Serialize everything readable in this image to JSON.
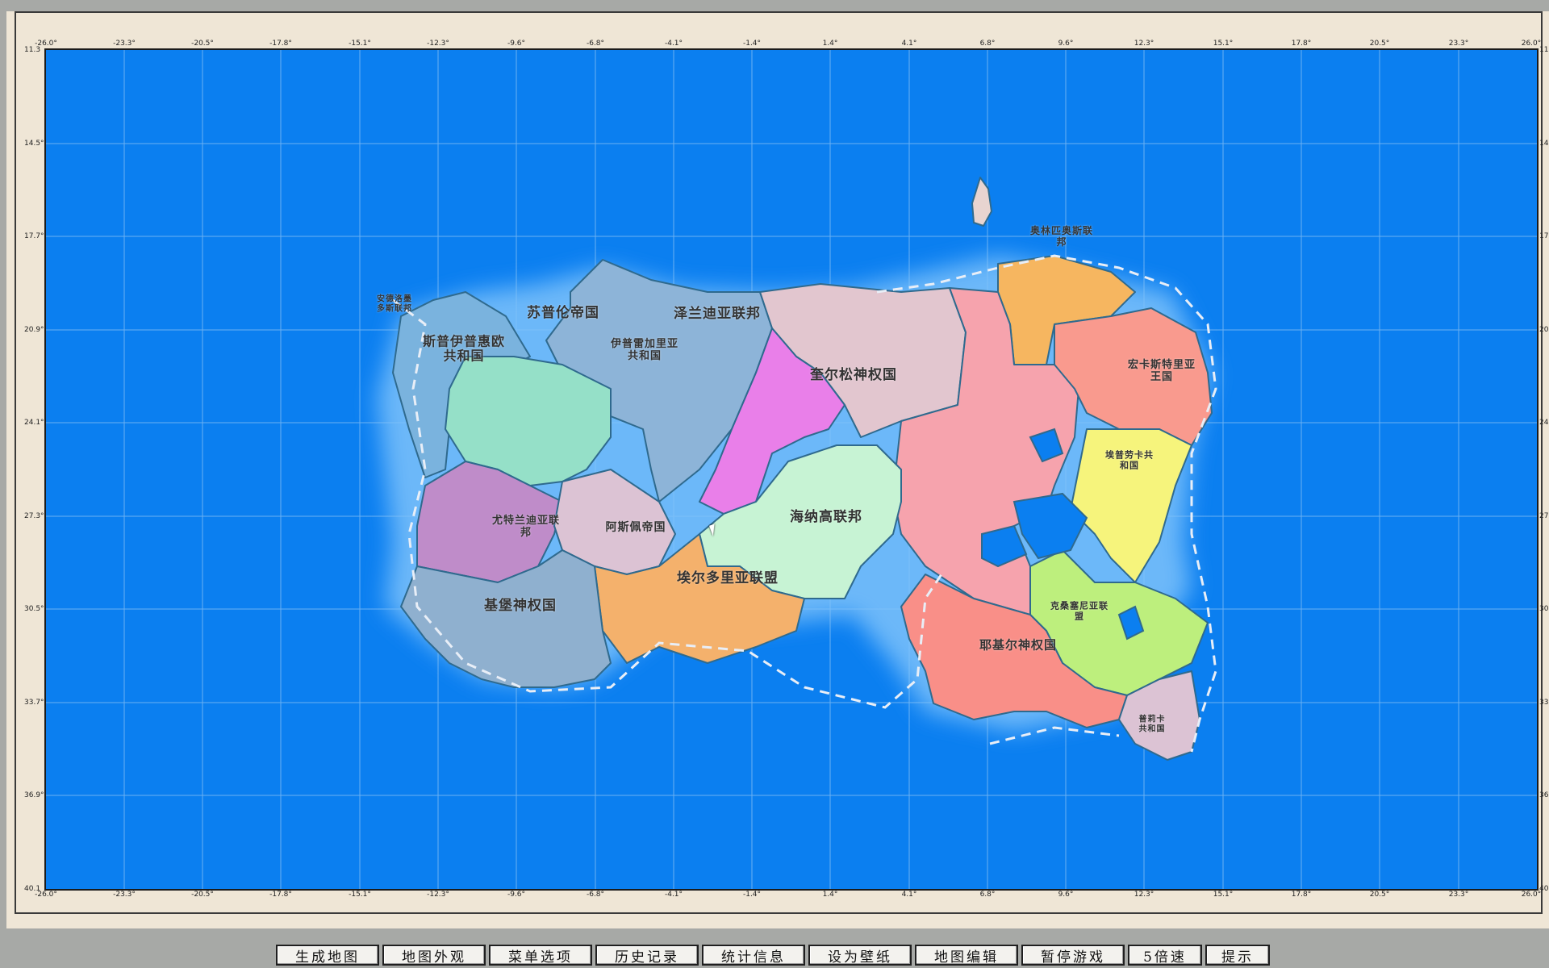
{
  "map": {
    "lon_labels": [
      "-26.0°",
      "-23.3°",
      "-20.5°",
      "-17.8°",
      "-15.1°",
      "-12.3°",
      "-9.6°",
      "-6.8°",
      "-4.1°",
      "-1.4°",
      "1.4°",
      "4.1°",
      "6.8°",
      "9.6°",
      "12.3°",
      "15.1°",
      "17.8°",
      "20.5°",
      "23.3°",
      "26.0°"
    ],
    "lat_labels": [
      "11.3°",
      "14.5°",
      "17.7°",
      "20.9°",
      "24.1°",
      "27.3°",
      "30.5°",
      "33.7°",
      "36.9°",
      "40.1°"
    ],
    "lat_labels_left": [
      "11.3",
      "14.5°",
      "17.7°",
      "20.9°",
      "24.1°",
      "27.3°",
      "30.5°",
      "33.7°",
      "36.9°",
      "40.1"
    ],
    "lat_labels_right": [
      "11.",
      "14.",
      "17.",
      "20.",
      "24.",
      "27.",
      "30.",
      "33.",
      "36.",
      "40."
    ],
    "ocean_color": "#0b7ff0",
    "countries": [
      {
        "name": "苏普伦帝国",
        "color": "#8db4d8"
      },
      {
        "name": "泽兰迪亚联邦",
        "color": "#e2c6cf"
      },
      {
        "name": "奥林匹奥斯联\n邦",
        "color": "#f6b660"
      },
      {
        "name": "安德洛墨\n多斯联邦",
        "color": "#7ab3de"
      },
      {
        "name": "斯普伊普惠欧\n共和国",
        "color": "#95e0c8"
      },
      {
        "name": "伊普雷加里亚\n共和国",
        "color": "#e97fe9"
      },
      {
        "name": "奎尔松神权国",
        "color": "#f6a3ad"
      },
      {
        "name": "宏卡斯特里亚\n王国",
        "color": "#f99a8e"
      },
      {
        "name": "埃普劳卡共\n和国",
        "color": "#f6f47c"
      },
      {
        "name": "尤特兰迪亚联\n邦",
        "color": "#bf8cc9"
      },
      {
        "name": "阿斯佩帝国",
        "color": "#dcc3d4"
      },
      {
        "name": "海纳高联邦",
        "color": "#c7f3d4"
      },
      {
        "name": "埃尔多里亚联盟",
        "color": "#f4b16c"
      },
      {
        "name": "基堡神权国",
        "color": "#8fb0cf"
      },
      {
        "name": "克桑塞尼亚联\n盟",
        "color": "#bdef7d"
      },
      {
        "name": "耶基尔神权国",
        "color": "#f98f88"
      },
      {
        "name": "普莉卡\n共和国",
        "color": "#dcc3d4"
      }
    ]
  },
  "toolbar": {
    "buttons": [
      "生成地图",
      "地图外观",
      "菜单选项",
      "历史记录",
      "统计信息",
      "设为壁纸",
      "地图编辑",
      "暂停游戏",
      "5倍速",
      "提示"
    ]
  }
}
